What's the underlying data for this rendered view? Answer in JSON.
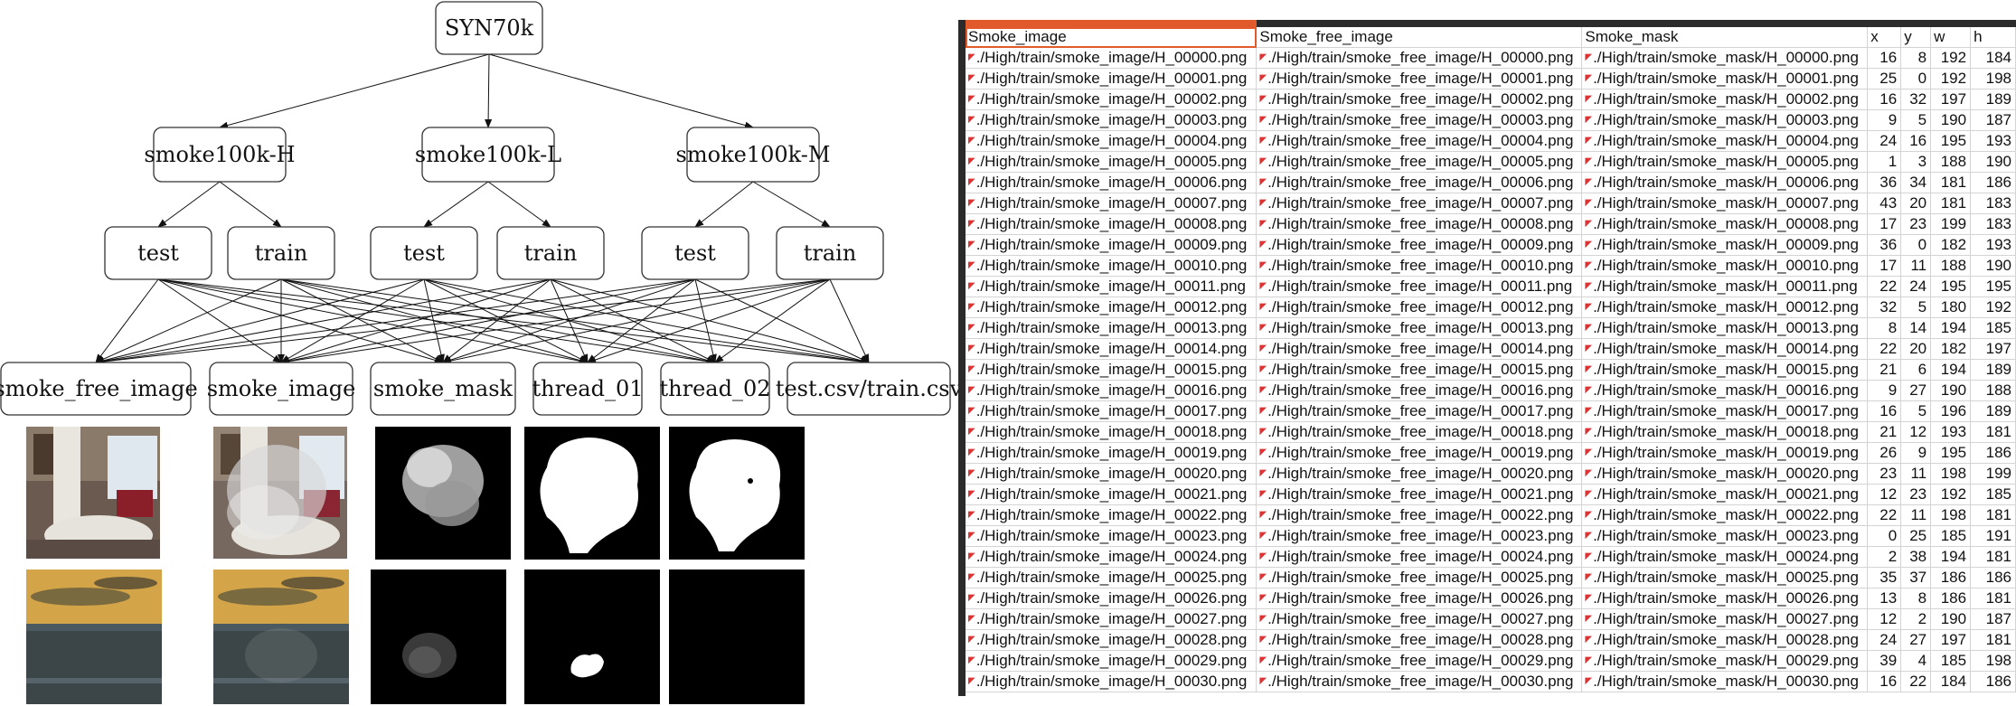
{
  "tree": {
    "root": "SYN70k",
    "datasets": [
      "smoke100k-H",
      "smoke100k-L",
      "smoke100k-M"
    ],
    "splits": [
      "test",
      "train",
      "test",
      "train",
      "test",
      "train"
    ],
    "folders": [
      "smoke_free_image",
      "smoke_image",
      "smoke_mask",
      "thread_01",
      "thread_02",
      "test.csv/train.csv"
    ]
  },
  "thumbnails": {
    "row1": [
      "smoke-free-bedroom",
      "smoky-bedroom",
      "smoke-mask-grey",
      "threshold-01-white-blob",
      "threshold-02-white-blob"
    ],
    "row2": [
      "smoke-free-sunset-sea",
      "smoky-sunset-sea",
      "smoke-mask-faint",
      "threshold-01-small-blob",
      "threshold-02-empty"
    ]
  },
  "colors": {
    "accent": "#e05a2b",
    "grid": "#d4d4d4",
    "dark": "#2b2b2b",
    "mark": "#dd3333"
  },
  "sheet": {
    "headers": [
      "Smoke_image",
      "Smoke_free_image",
      "Smoke_mask",
      "x",
      "y",
      "w",
      "h"
    ],
    "rows": [
      [
        "./High/train/smoke_image/H_00000.png",
        "./High/train/smoke_free_image/H_00000.png",
        "./High/train/smoke_mask/H_00000.png",
        "16",
        "8",
        "192",
        "184"
      ],
      [
        "./High/train/smoke_image/H_00001.png",
        "./High/train/smoke_free_image/H_00001.png",
        "./High/train/smoke_mask/H_00001.png",
        "25",
        "0",
        "192",
        "198"
      ],
      [
        "./High/train/smoke_image/H_00002.png",
        "./High/train/smoke_free_image/H_00002.png",
        "./High/train/smoke_mask/H_00002.png",
        "16",
        "32",
        "197",
        "189"
      ],
      [
        "./High/train/smoke_image/H_00003.png",
        "./High/train/smoke_free_image/H_00003.png",
        "./High/train/smoke_mask/H_00003.png",
        "9",
        "5",
        "190",
        "187"
      ],
      [
        "./High/train/smoke_image/H_00004.png",
        "./High/train/smoke_free_image/H_00004.png",
        "./High/train/smoke_mask/H_00004.png",
        "24",
        "16",
        "195",
        "193"
      ],
      [
        "./High/train/smoke_image/H_00005.png",
        "./High/train/smoke_free_image/H_00005.png",
        "./High/train/smoke_mask/H_00005.png",
        "1",
        "3",
        "188",
        "190"
      ],
      [
        "./High/train/smoke_image/H_00006.png",
        "./High/train/smoke_free_image/H_00006.png",
        "./High/train/smoke_mask/H_00006.png",
        "36",
        "34",
        "181",
        "186"
      ],
      [
        "./High/train/smoke_image/H_00007.png",
        "./High/train/smoke_free_image/H_00007.png",
        "./High/train/smoke_mask/H_00007.png",
        "43",
        "20",
        "181",
        "183"
      ],
      [
        "./High/train/smoke_image/H_00008.png",
        "./High/train/smoke_free_image/H_00008.png",
        "./High/train/smoke_mask/H_00008.png",
        "17",
        "23",
        "199",
        "183"
      ],
      [
        "./High/train/smoke_image/H_00009.png",
        "./High/train/smoke_free_image/H_00009.png",
        "./High/train/smoke_mask/H_00009.png",
        "36",
        "0",
        "182",
        "193"
      ],
      [
        "./High/train/smoke_image/H_00010.png",
        "./High/train/smoke_free_image/H_00010.png",
        "./High/train/smoke_mask/H_00010.png",
        "17",
        "11",
        "188",
        "190"
      ],
      [
        "./High/train/smoke_image/H_00011.png",
        "./High/train/smoke_free_image/H_00011.png",
        "./High/train/smoke_mask/H_00011.png",
        "22",
        "24",
        "195",
        "195"
      ],
      [
        "./High/train/smoke_image/H_00012.png",
        "./High/train/smoke_free_image/H_00012.png",
        "./High/train/smoke_mask/H_00012.png",
        "32",
        "5",
        "180",
        "192"
      ],
      [
        "./High/train/smoke_image/H_00013.png",
        "./High/train/smoke_free_image/H_00013.png",
        "./High/train/smoke_mask/H_00013.png",
        "8",
        "14",
        "194",
        "185"
      ],
      [
        "./High/train/smoke_image/H_00014.png",
        "./High/train/smoke_free_image/H_00014.png",
        "./High/train/smoke_mask/H_00014.png",
        "22",
        "20",
        "182",
        "197"
      ],
      [
        "./High/train/smoke_image/H_00015.png",
        "./High/train/smoke_free_image/H_00015.png",
        "./High/train/smoke_mask/H_00015.png",
        "21",
        "6",
        "194",
        "189"
      ],
      [
        "./High/train/smoke_image/H_00016.png",
        "./High/train/smoke_free_image/H_00016.png",
        "./High/train/smoke_mask/H_00016.png",
        "9",
        "27",
        "190",
        "188"
      ],
      [
        "./High/train/smoke_image/H_00017.png",
        "./High/train/smoke_free_image/H_00017.png",
        "./High/train/smoke_mask/H_00017.png",
        "16",
        "5",
        "196",
        "189"
      ],
      [
        "./High/train/smoke_image/H_00018.png",
        "./High/train/smoke_free_image/H_00018.png",
        "./High/train/smoke_mask/H_00018.png",
        "21",
        "12",
        "193",
        "181"
      ],
      [
        "./High/train/smoke_image/H_00019.png",
        "./High/train/smoke_free_image/H_00019.png",
        "./High/train/smoke_mask/H_00019.png",
        "26",
        "9",
        "195",
        "186"
      ],
      [
        "./High/train/smoke_image/H_00020.png",
        "./High/train/smoke_free_image/H_00020.png",
        "./High/train/smoke_mask/H_00020.png",
        "23",
        "11",
        "198",
        "199"
      ],
      [
        "./High/train/smoke_image/H_00021.png",
        "./High/train/smoke_free_image/H_00021.png",
        "./High/train/smoke_mask/H_00021.png",
        "12",
        "23",
        "192",
        "185"
      ],
      [
        "./High/train/smoke_image/H_00022.png",
        "./High/train/smoke_free_image/H_00022.png",
        "./High/train/smoke_mask/H_00022.png",
        "22",
        "11",
        "198",
        "181"
      ],
      [
        "./High/train/smoke_image/H_00023.png",
        "./High/train/smoke_free_image/H_00023.png",
        "./High/train/smoke_mask/H_00023.png",
        "0",
        "25",
        "185",
        "191"
      ],
      [
        "./High/train/smoke_image/H_00024.png",
        "./High/train/smoke_free_image/H_00024.png",
        "./High/train/smoke_mask/H_00024.png",
        "2",
        "38",
        "194",
        "181"
      ],
      [
        "./High/train/smoke_image/H_00025.png",
        "./High/train/smoke_free_image/H_00025.png",
        "./High/train/smoke_mask/H_00025.png",
        "35",
        "37",
        "186",
        "186"
      ],
      [
        "./High/train/smoke_image/H_00026.png",
        "./High/train/smoke_free_image/H_00026.png",
        "./High/train/smoke_mask/H_00026.png",
        "13",
        "8",
        "186",
        "181"
      ],
      [
        "./High/train/smoke_image/H_00027.png",
        "./High/train/smoke_free_image/H_00027.png",
        "./High/train/smoke_mask/H_00027.png",
        "12",
        "2",
        "190",
        "187"
      ],
      [
        "./High/train/smoke_image/H_00028.png",
        "./High/train/smoke_free_image/H_00028.png",
        "./High/train/smoke_mask/H_00028.png",
        "24",
        "27",
        "197",
        "181"
      ],
      [
        "./High/train/smoke_image/H_00029.png",
        "./High/train/smoke_free_image/H_00029.png",
        "./High/train/smoke_mask/H_00029.png",
        "39",
        "4",
        "185",
        "198"
      ],
      [
        "./High/train/smoke_image/H_00030.png",
        "./High/train/smoke_free_image/H_00030.png",
        "./High/train/smoke_mask/H_00030.png",
        "16",
        "22",
        "184",
        "186"
      ]
    ]
  }
}
